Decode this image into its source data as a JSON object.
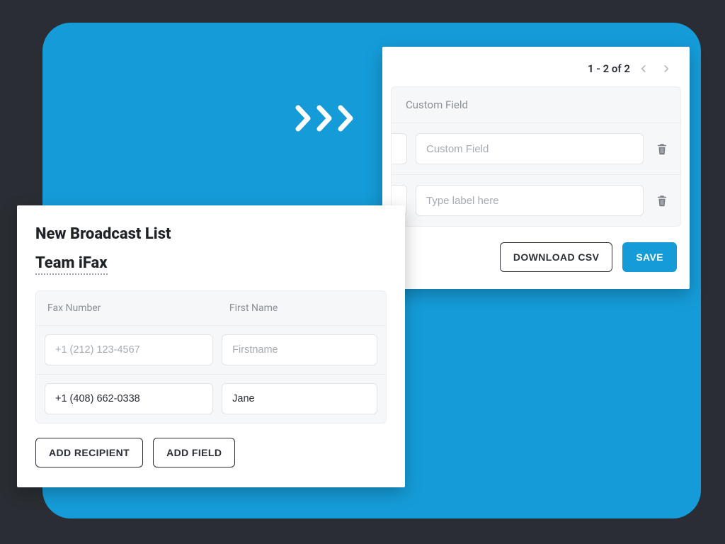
{
  "pager": {
    "text": "1 - 2 of 2"
  },
  "custom_field": {
    "header": "Custom Field",
    "rows": [
      {
        "placeholder": "Custom Field",
        "value": ""
      },
      {
        "placeholder": "Type label here",
        "value": ""
      }
    ]
  },
  "actions_right": {
    "download_csv": "DOWNLOAD CSV",
    "save": "SAVE"
  },
  "left": {
    "title": "New Broadcast List",
    "team_name": "Team iFax",
    "columns": {
      "fax": "Fax Number",
      "first_name": "First Name"
    },
    "rows": [
      {
        "fax_placeholder": "+1 (212) 123-4567",
        "fax_value": "",
        "fn_placeholder": "Firstname",
        "fn_value": ""
      },
      {
        "fax_placeholder": "",
        "fax_value": "+1 (408) 662-0338",
        "fn_placeholder": "",
        "fn_value": "Jane"
      }
    ],
    "add_recipient": "ADD RECIPIENT",
    "add_field": "ADD FIELD"
  }
}
